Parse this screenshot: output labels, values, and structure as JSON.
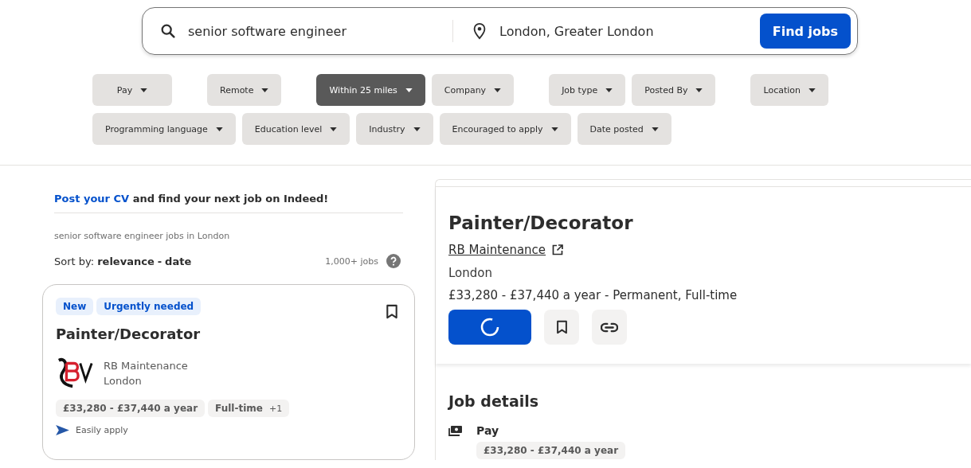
{
  "search": {
    "what": "senior software engineer",
    "where": "London, Greater London",
    "button": "Find jobs"
  },
  "filter_rows": [
    [
      {
        "label": "Pay",
        "selected": false
      },
      {
        "label": "Remote",
        "selected": false
      },
      {
        "label": "Within 25 miles",
        "selected": true
      },
      {
        "label": "Company",
        "selected": false
      },
      {
        "label": "Job type",
        "selected": false
      },
      {
        "label": "Posted By",
        "selected": false
      },
      {
        "label": "Location",
        "selected": false
      }
    ],
    [
      {
        "label": "Programming language",
        "selected": false
      },
      {
        "label": "Education level",
        "selected": false
      },
      {
        "label": "Industry",
        "selected": false
      },
      {
        "label": "Encouraged to apply",
        "selected": false
      },
      {
        "label": "Date posted",
        "selected": false
      }
    ]
  ],
  "promo": {
    "link": "Post your CV",
    "text": "and find your next job on Indeed!"
  },
  "results": {
    "heading": "senior software engineer jobs in London",
    "sort_label": "Sort by:",
    "sort_options": [
      "relevance",
      "date"
    ],
    "sort_separator": "-",
    "count": "1,000+ jobs"
  },
  "job_card": {
    "badges": [
      "New",
      "Urgently needed"
    ],
    "title": "Painter/Decorator",
    "company": "RB Maintenance",
    "location": "London",
    "tags": [
      {
        "text": "£33,280 - £37,440 a year"
      },
      {
        "text": "Full-time",
        "extra": "+1"
      }
    ],
    "easy_apply": "Easily apply"
  },
  "detail": {
    "title": "Painter/Decorator",
    "company": "RB Maintenance",
    "location": "London",
    "salary": "£33,280 - £37,440 a year",
    "job_type": " - Permanent, Full-time",
    "section_title": "Job details",
    "pay_label": "Pay",
    "pay_value": "£33,280 - £37,440 a year"
  }
}
